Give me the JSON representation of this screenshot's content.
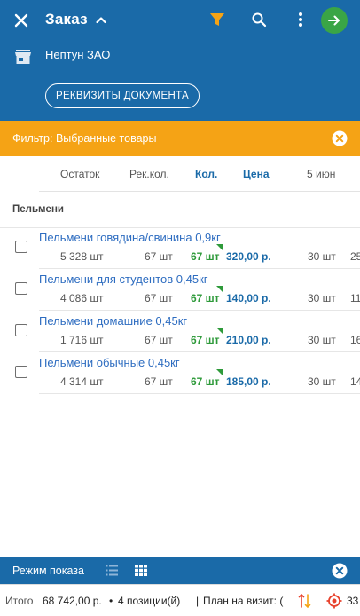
{
  "header": {
    "title": "Заказ",
    "contractor": "Нептун ЗАО",
    "requisites_button": "РЕКВИЗИТЫ ДОКУМЕНТА",
    "accent_color": "#1a6aa8",
    "filter_icon_color": "#f5a315",
    "next_button_color": "#3aa546"
  },
  "filter": {
    "text": "Фильтр: Выбранные товары",
    "color": "#f5a315"
  },
  "columns": {
    "stock": "Остаток",
    "recommended": "Рек.кол.",
    "quantity": "Кол.",
    "price": "Цена",
    "date": "5 июн"
  },
  "group": {
    "name": "Пельмени"
  },
  "products": [
    {
      "name": "Пельмени говядина/свинина 0,9кг",
      "stock": "5 328 шт",
      "recommended": "67 шт",
      "quantity": "67 шт",
      "price": "320,00 р.",
      "date_qty": "30 шт",
      "extra": "25"
    },
    {
      "name": "Пельмени для студентов 0,45кг",
      "stock": "4 086 шт",
      "recommended": "67 шт",
      "quantity": "67 шт",
      "price": "140,00 р.",
      "date_qty": "30 шт",
      "extra": "11"
    },
    {
      "name": "Пельмени домашние 0,45кг",
      "stock": "1 716 шт",
      "recommended": "67 шт",
      "quantity": "67 шт",
      "price": "210,00 р.",
      "date_qty": "30 шт",
      "extra": "16"
    },
    {
      "name": "Пельмени обычные 0,45кг",
      "stock": "4 314 шт",
      "recommended": "67 шт",
      "quantity": "67 шт",
      "price": "185,00 р.",
      "date_qty": "30 шт",
      "extra": "14"
    }
  ],
  "mode_bar": {
    "label": "Режим показа"
  },
  "totals": {
    "label": "Итого",
    "sum": "68 742,00 р.",
    "bullet": "•",
    "positions": "4 позиции(й)",
    "divider": "|",
    "plan": "План на визит: (",
    "target_value": "33"
  }
}
